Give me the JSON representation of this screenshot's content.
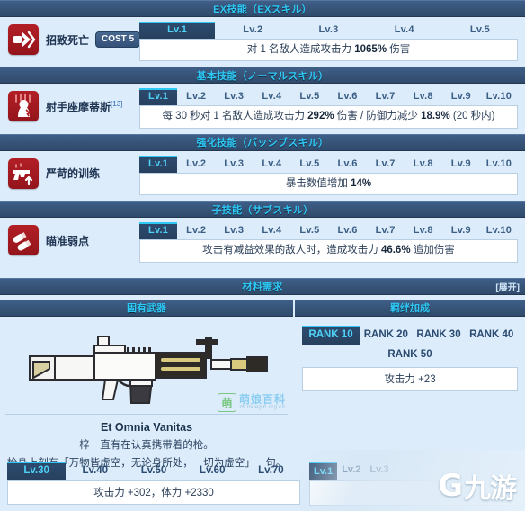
{
  "colors": {
    "header_bar": "#37547a",
    "header_text": "#2ec8f5",
    "page_bg": "#dcecfb",
    "skill_icon": "#a8191f",
    "active_tab": "#2d4a6d",
    "active_tab_accent": "#2ec8f5"
  },
  "sections": [
    {
      "id": "ex-skill",
      "header": "EX技能（EXスキル）",
      "skill": {
        "icon": "arrow-burst-icon",
        "name": "招致死亡",
        "cost_label": "COST 5",
        "levels": [
          "Lv.1",
          "Lv.2",
          "Lv.3",
          "Lv.4",
          "Lv.5"
        ],
        "active_level": 0,
        "description_parts": [
          {
            "t": "对 1 名敌人造成攻击力 ",
            "b": false
          },
          {
            "t": "1065%",
            "b": true
          },
          {
            "t": " 伤害",
            "b": false
          }
        ],
        "description": "对 1 名敌人造成攻击力 1065% 伤害"
      }
    },
    {
      "id": "normal-skill",
      "header": "基本技能（ノーマルスキル）",
      "skill": {
        "icon": "ghost-hand-icon",
        "name": "射手座摩蒂斯",
        "name_sup": "[13]",
        "cost_label": "",
        "levels": [
          "Lv.1",
          "Lv.2",
          "Lv.3",
          "Lv.4",
          "Lv.5",
          "Lv.6",
          "Lv.7",
          "Lv.8",
          "Lv.9",
          "Lv.10"
        ],
        "active_level": 0,
        "description_parts": [
          {
            "t": "每 30 秒对 1 名敌人造成攻击力 ",
            "b": false
          },
          {
            "t": "292%",
            "b": true
          },
          {
            "t": " 伤害 / 防御力减少 ",
            "b": false
          },
          {
            "t": "18.9%",
            "b": true
          },
          {
            "t": " (20 秒内)",
            "b": false
          }
        ],
        "description": "每 30 秒对 1 名敌人造成攻击力 292% 伤害 / 防御力减少 18.9% (20 秒内)"
      }
    },
    {
      "id": "passive-skill",
      "header": "强化技能（パッシブスキル）",
      "skill": {
        "icon": "pistol-up-icon",
        "name": "严苛的训练",
        "cost_label": "",
        "levels": [
          "Lv.1",
          "Lv.2",
          "Lv.3",
          "Lv.4",
          "Lv.5",
          "Lv.6",
          "Lv.7",
          "Lv.8",
          "Lv.9",
          "Lv.10"
        ],
        "active_level": 0,
        "description_parts": [
          {
            "t": "暴击数值增加 ",
            "b": false
          },
          {
            "t": "14%",
            "b": true
          }
        ],
        "description": "暴击数值增加 14%"
      }
    },
    {
      "id": "sub-skill",
      "header": "子技能（サブスキル）",
      "skill": {
        "icon": "bullets-icon",
        "name": "瞄准弱点",
        "cost_label": "",
        "levels": [
          "Lv.1",
          "Lv.2",
          "Lv.3",
          "Lv.4",
          "Lv.5",
          "Lv.6",
          "Lv.7",
          "Lv.8",
          "Lv.9",
          "Lv.10"
        ],
        "active_level": 0,
        "description_parts": [
          {
            "t": "攻击有减益效果的敌人时，造成攻击力 ",
            "b": false
          },
          {
            "t": "46.6%",
            "b": true
          },
          {
            "t": " 追加伤害",
            "b": false
          }
        ],
        "description": "攻击有减益效果的敌人时，造成攻击力 46.6% 追加伤害"
      }
    }
  ],
  "material": {
    "header": "材料需求",
    "expand_label": "[展开]"
  },
  "weapon": {
    "header": "固有武器",
    "title": "Et Omnia Vanitas",
    "desc_line1": "梓一直有在认真携带着的枪。",
    "desc_line2": "枪身上刻有「万物皆虚空，无论身所处，一切为虚空」一句。",
    "levels": [
      "Lv.30",
      "Lv.40",
      "Lv.50",
      "Lv.60",
      "Lv.70"
    ],
    "active_level": 0,
    "stats": "攻击力 +302，体力 +2330"
  },
  "bond": {
    "header": "羁绊加成",
    "ranks_row1": [
      "RANK 10",
      "RANK 20",
      "RANK 30",
      "RANK 40"
    ],
    "ranks_row2": [
      "RANK 50"
    ],
    "active_rank": 0,
    "stats": "攻击力 +23",
    "bottom_levels": [
      "Lv.1",
      "Lv.2",
      "Lv.3"
    ],
    "bottom_active": 0
  },
  "watermarks": {
    "moegirl_glyph": "萌",
    "moegirl_title": "萌娘百科",
    "moegirl_url": "zh.moegirl.org.cn",
    "ninegame": "九游"
  }
}
